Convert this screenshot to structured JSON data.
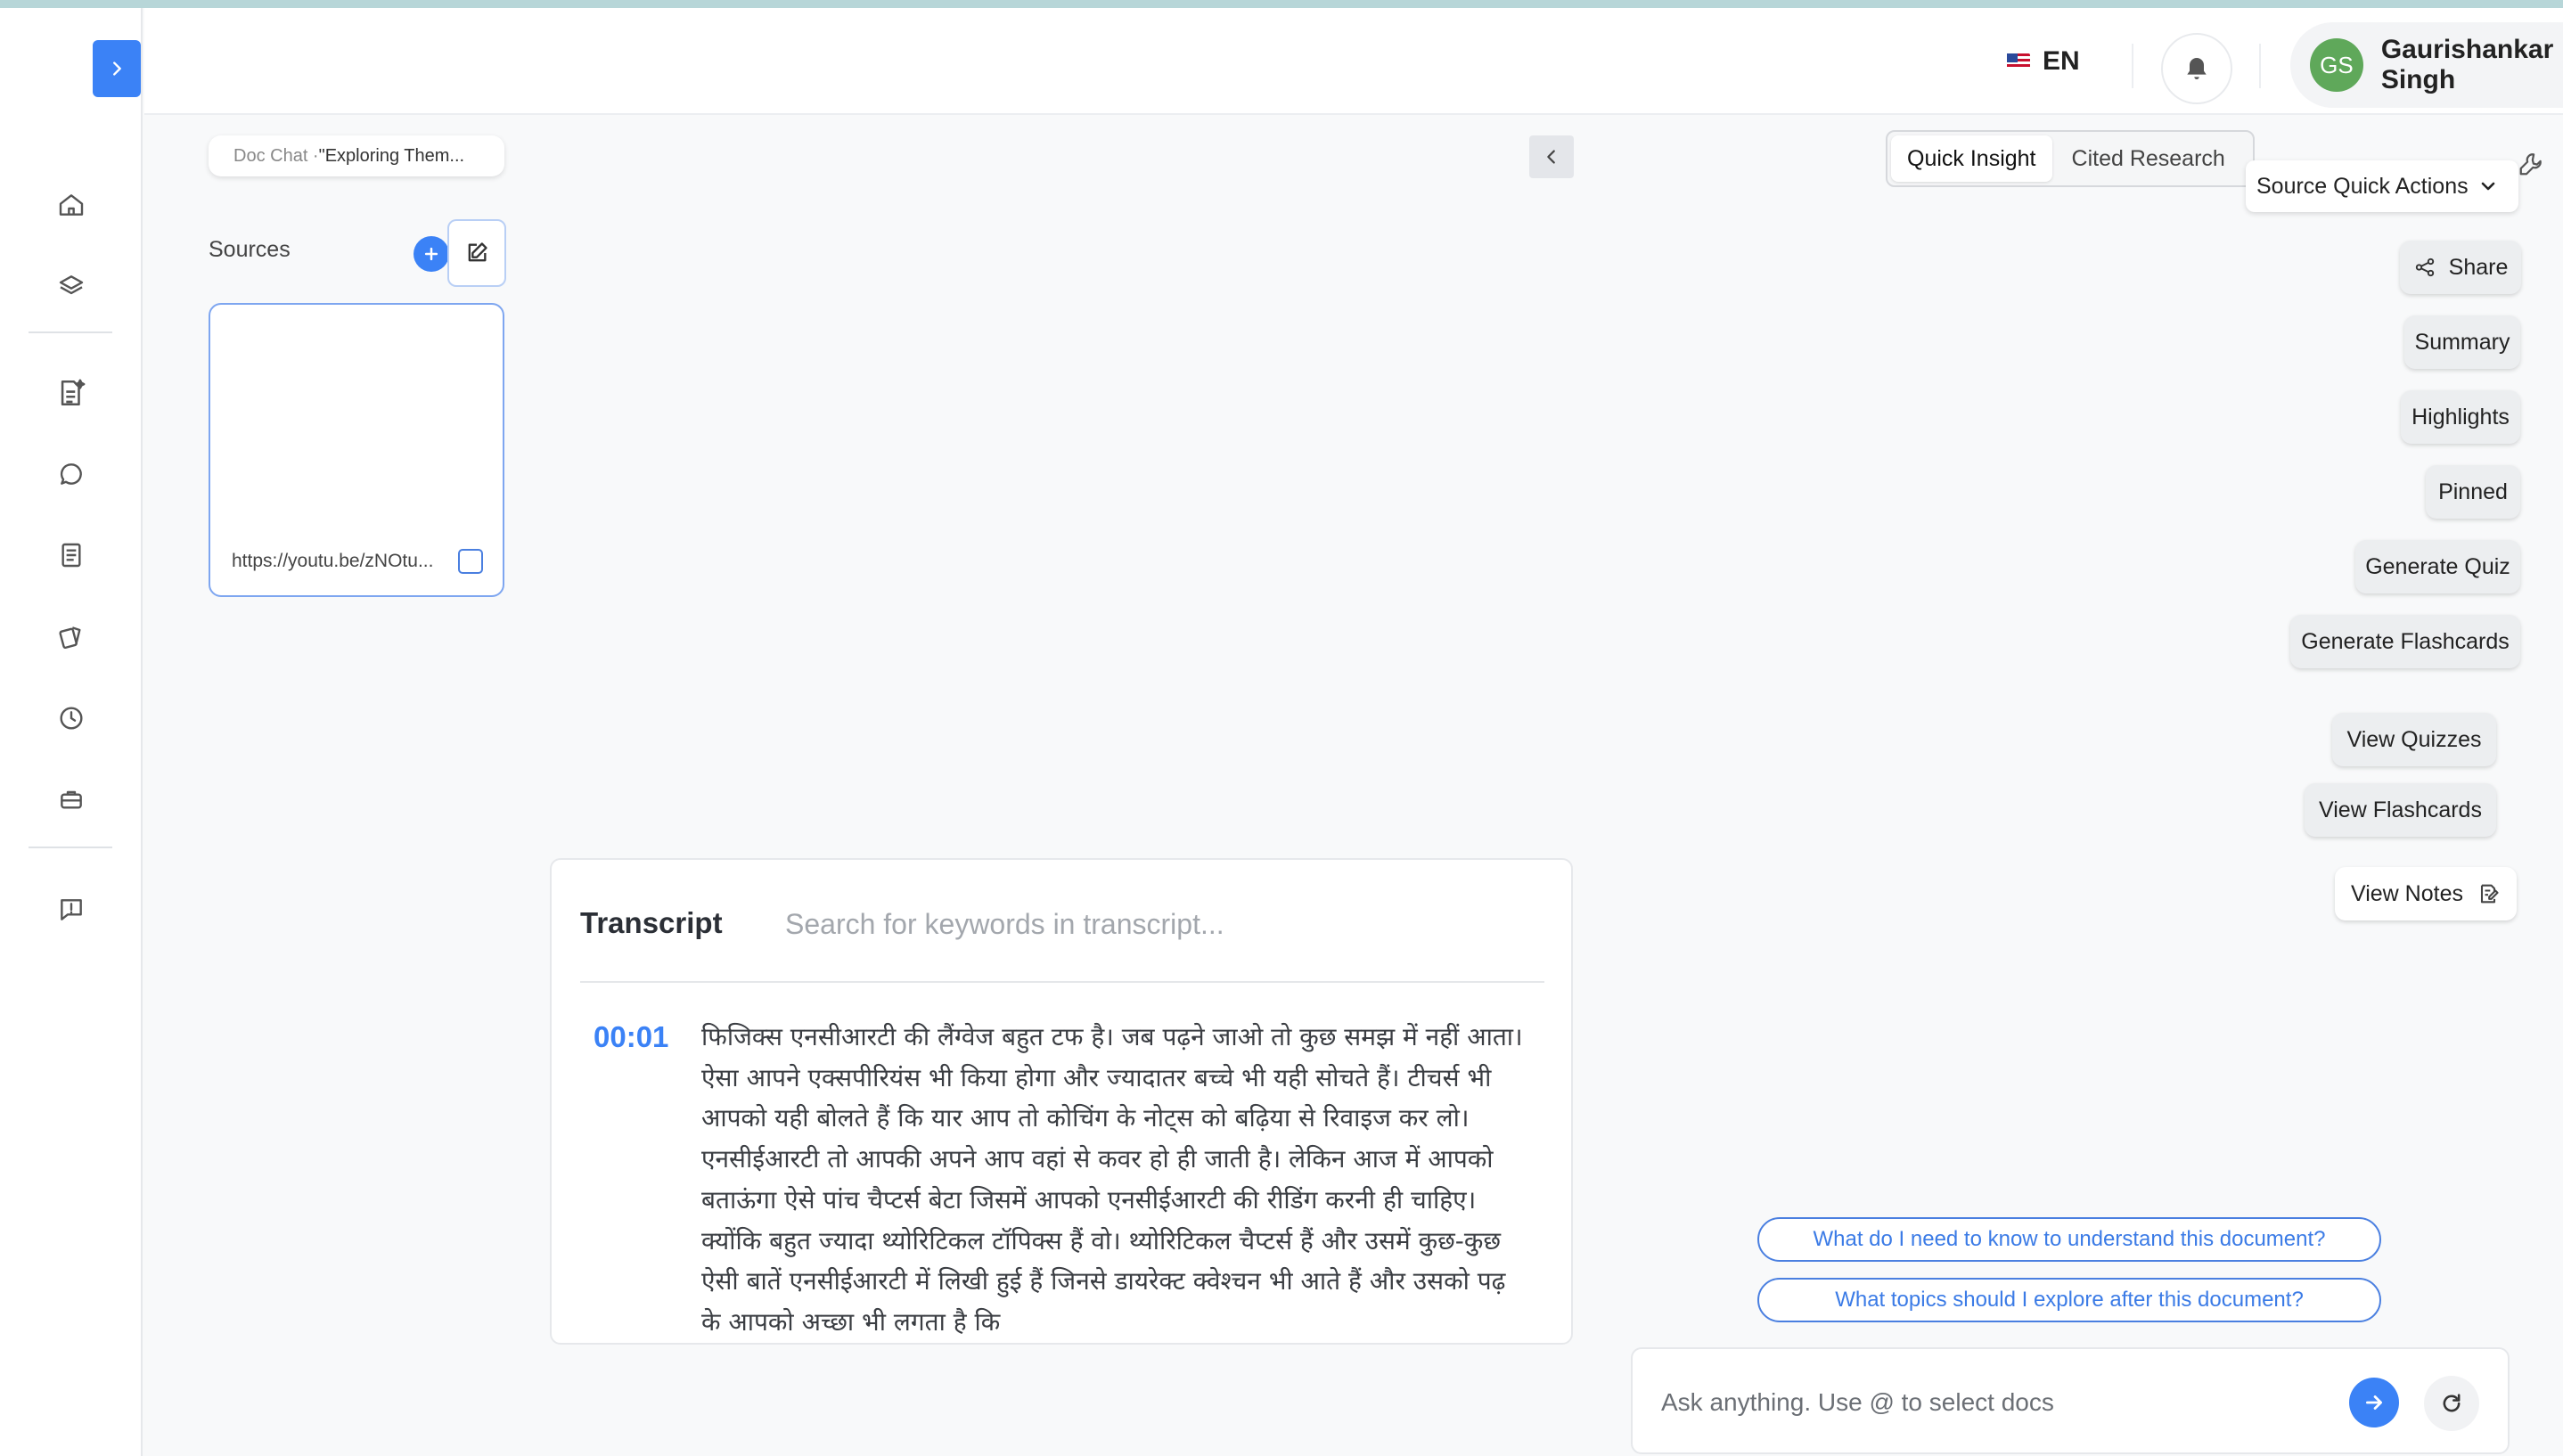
{
  "header": {
    "language": "EN",
    "user": {
      "initials": "GS",
      "name": "Gaurishankar Singh"
    }
  },
  "breadcrumb": {
    "prefix": "Doc Chat · ",
    "title": "\"Exploring Them..."
  },
  "sources": {
    "label": "Sources",
    "items": [
      {
        "url": "https://youtu.be/zNOtu..."
      }
    ]
  },
  "transcript": {
    "title": "Transcript",
    "search_placeholder": "Search for keywords in transcript...",
    "entries": [
      {
        "time": "00:01",
        "text": "फिजिक्स एनसीआरटी की लैंग्वेज बहुत टफ है। जब पढ़ने जाओ तो कुछ समझ में नहीं आता। ऐसा आपने एक्सपीरियंस भी किया होगा और ज्यादातर बच्चे भी यही सोचते हैं। टीचर्स भी आपको यही बोलते हैं कि यार आप तो कोचिंग के नोट्स को बढ़िया से रिवाइज कर लो। एनसीईआरटी तो आपकी अपने आप वहां से कवर हो ही जाती है। लेकिन आज में आपको बताऊंगा ऐसे पांच चैप्टर्स बेटा जिसमें आपको एनसीईआरटी की रीडिंग करनी ही चाहिए। क्योंकि बहुत ज्यादा थ्योरिटिकल टॉपिक्स हैं वो। थ्योरिटिकल चैप्टर्स हैं और उसमें कुछ-कुछ ऐसी बातें एनसीईआरटी में लिखी हुई हैं जिनसे डायरेक्ट क्वेश्चन भी आते हैं और उसको पढ़ के आपको अच्छा भी लगता है कि"
      }
    ]
  },
  "right_panel": {
    "modes": [
      "Quick Insight",
      "Cited Research"
    ],
    "active_mode": "Quick Insight",
    "source_quick_actions": "Source Quick Actions",
    "actions": {
      "share": "Share",
      "summary": "Summary",
      "highlights": "Highlights",
      "pinned": "Pinned",
      "generate_quiz": "Generate Quiz",
      "generate_flashcards": "Generate Flashcards",
      "view_quizzes": "View Quizzes",
      "view_flashcards": "View Flashcards",
      "view_notes": "View Notes"
    },
    "suggestions": [
      "What do I need to know to understand this document?",
      "What topics should I explore after this document?"
    ],
    "ask_placeholder": "Ask anything. Use @ to select docs"
  },
  "colors": {
    "accent": "#3b82f6",
    "avatar_bg": "#5fa85a",
    "rail_bg": "#ffffff"
  },
  "icons": {
    "rail": [
      "home-icon",
      "layers-icon",
      "ai-document-icon",
      "chat-icon",
      "notes-icon",
      "cards-icon",
      "history-icon",
      "briefcase-icon",
      "feedback-icon"
    ]
  }
}
